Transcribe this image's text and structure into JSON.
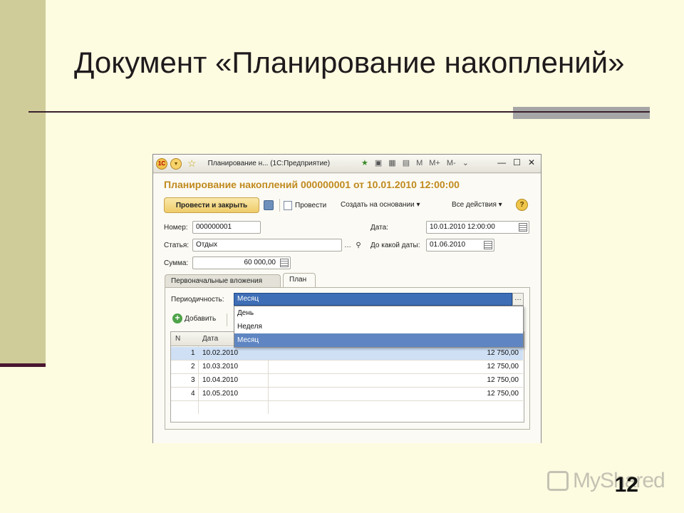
{
  "slide": {
    "title": "Документ «Планирование накоплений»",
    "page_number": "12",
    "watermark": "MyShared"
  },
  "window": {
    "title": "Планирование н... (1С:Предприятие)",
    "toolbar_icons": [
      "M",
      "M+",
      "M-"
    ],
    "doc_title": "Планирование накоплений 000000001 от 10.01.2010 12:00:00",
    "commands": {
      "post_close": "Провести и закрыть",
      "post": "Провести",
      "create_based": "Создать на основании",
      "all_actions": "Все действия",
      "help": "?"
    },
    "fields": {
      "number_label": "Номер:",
      "number_value": "000000001",
      "date_label": "Дата:",
      "date_value": "10.01.2010 12:00:00",
      "article_label": "Статья:",
      "article_value": "Отдых",
      "until_label": "До какой даты:",
      "until_value": "01.06.2010",
      "sum_label": "Сумма:",
      "sum_value": "60 000,00"
    },
    "tabs": [
      "Первоначальные вложения",
      "План"
    ],
    "active_tab": "План",
    "periodicity_label": "Периодичность:",
    "periodicity_value": "Месяц",
    "periodicity_options": [
      "День",
      "Неделя",
      "Месяц"
    ],
    "add_button": "Добавить",
    "table": {
      "columns": [
        "N",
        "Дата"
      ],
      "rows": [
        {
          "n": "1",
          "date": "10.02.2010",
          "sum": "12 750,00"
        },
        {
          "n": "2",
          "date": "10.03.2010",
          "sum": "12 750,00"
        },
        {
          "n": "3",
          "date": "10.04.2010",
          "sum": "12 750,00"
        },
        {
          "n": "4",
          "date": "10.05.2010",
          "sum": "12 750,00"
        }
      ]
    }
  }
}
